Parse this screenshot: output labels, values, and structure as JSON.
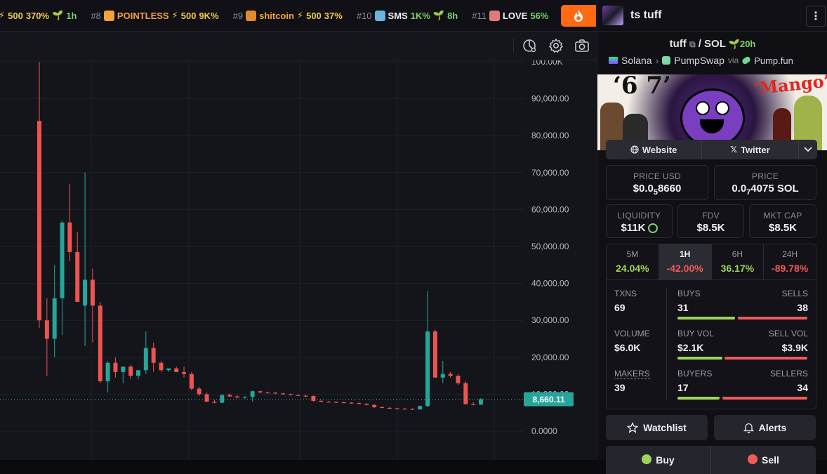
{
  "ticker": {
    "items": [
      {
        "rank": "",
        "name": "",
        "boost": "500",
        "change": "370%",
        "timeframe": "1h",
        "icon_color": ""
      },
      {
        "rank": "#8",
        "name": "POINTLESS",
        "boost": "500",
        "change": "9K%",
        "timeframe": "",
        "icon_color": "#f2a33a"
      },
      {
        "rank": "#9",
        "name": "shitcoin",
        "boost": "500",
        "change": "37%",
        "timeframe": "",
        "icon_color": "#e08a2a"
      },
      {
        "rank": "#10",
        "name": "SMS",
        "boost": "",
        "change": "1K%",
        "timeframe": "8h",
        "icon_color": "#6bb4e0"
      },
      {
        "rank": "#11",
        "name": "LOVE",
        "boost": "",
        "change": "56%",
        "timeframe": "",
        "icon_color": "#e07a7a"
      }
    ],
    "hot_icon": "fire-icon"
  },
  "toolbar": {
    "icons": [
      "indicator-icon",
      "gear-icon",
      "camera-icon"
    ]
  },
  "pair": {
    "title": "ts tuff",
    "base": "tuff",
    "separator": "/",
    "quote": "SOL",
    "age": "20h",
    "chain": "Solana",
    "dex": "PumpSwap",
    "via": "via",
    "launchpad": "Pump.fun"
  },
  "banner": {
    "text_left": "‘6 7’",
    "text_right": "‘Mango’"
  },
  "links": {
    "website": "Website",
    "twitter": "Twitter"
  },
  "prices": {
    "usd_label": "PRICE USD",
    "usd_prefix": "$0.0",
    "usd_sub": "5",
    "usd_rest": "8660",
    "native_label": "PRICE",
    "native_prefix": "0.0",
    "native_sub": "7",
    "native_rest": "4075 SOL"
  },
  "metrics": {
    "liquidity_label": "LIQUIDITY",
    "liquidity": "$11K",
    "fdv_label": "FDV",
    "fdv": "$8.5K",
    "mcap_label": "MKT CAP",
    "mcap": "$8.5K"
  },
  "timeframes": [
    {
      "label": "5M",
      "change": "24.04%",
      "dir": "pos"
    },
    {
      "label": "1H",
      "change": "-42.00%",
      "dir": "neg"
    },
    {
      "label": "6H",
      "change": "36.17%",
      "dir": "pos"
    },
    {
      "label": "24H",
      "change": "-89.78%",
      "dir": "neg"
    }
  ],
  "stats": {
    "txns_label": "TXNS",
    "txns": "69",
    "buys_label": "BUYS",
    "buys": "31",
    "sells_label": "SELLS",
    "sells": "38",
    "volume_label": "VOLUME",
    "volume": "$6.0K",
    "buyvol_label": "BUY VOL",
    "buyvol": "$2.1K",
    "sellvol_label": "SELL VOL",
    "sellvol": "$3.9K",
    "makers_label": "MAKERS",
    "makers": "39",
    "buyers_label": "BUYERS",
    "buyers": "17",
    "sellers_label": "SELLERS",
    "sellers": "34"
  },
  "actions": {
    "watchlist": "Watchlist",
    "alerts": "Alerts",
    "buy": "Buy",
    "sell": "Sell"
  },
  "colors": {
    "up": "#26a69a",
    "down": "#ef5350",
    "accent": "#ff6a13"
  },
  "chart_data": {
    "type": "candlestick",
    "y_tick_labels": [
      "100.00K",
      "90,000.00",
      "80,000.00",
      "70,000.00",
      "60,000.00",
      "50,000.00",
      "40,000.00",
      "30,000.00",
      "20,000.00",
      "10,000.00",
      "0.0000"
    ],
    "y_ticks": [
      100000,
      90000,
      80000,
      70000,
      60000,
      50000,
      40000,
      30000,
      20000,
      10000,
      0
    ],
    "ylim": [
      0,
      100000
    ],
    "current_price": 8660.11,
    "current_price_label": "8,660.11",
    "candles": [
      {
        "o": 84000,
        "h": 100000,
        "l": 28000,
        "c": 30000
      },
      {
        "o": 30000,
        "h": 36000,
        "l": 15000,
        "c": 25000
      },
      {
        "o": 25000,
        "h": 45000,
        "l": 20000,
        "c": 36000
      },
      {
        "o": 36000,
        "h": 57000,
        "l": 26000,
        "c": 56500
      },
      {
        "o": 56500,
        "h": 67000,
        "l": 46000,
        "c": 48500
      },
      {
        "o": 48500,
        "h": 54000,
        "l": 39000,
        "c": 35000
      },
      {
        "o": 34000,
        "h": 70000,
        "l": 23000,
        "c": 41000
      },
      {
        "o": 41000,
        "h": 44000,
        "l": 24000,
        "c": 34000
      },
      {
        "o": 34000,
        "h": 35000,
        "l": 13000,
        "c": 13500
      },
      {
        "o": 13500,
        "h": 19000,
        "l": 10500,
        "c": 18500
      },
      {
        "o": 18500,
        "h": 20000,
        "l": 14500,
        "c": 16000
      },
      {
        "o": 16000,
        "h": 17000,
        "l": 13000,
        "c": 17500
      },
      {
        "o": 17500,
        "h": 18000,
        "l": 14000,
        "c": 15000
      },
      {
        "o": 15000,
        "h": 16500,
        "l": 14000,
        "c": 16500
      },
      {
        "o": 16500,
        "h": 27000,
        "l": 15500,
        "c": 22500
      },
      {
        "o": 22500,
        "h": 24000,
        "l": 16000,
        "c": 18500
      },
      {
        "o": 18500,
        "h": 19000,
        "l": 16000,
        "c": 16500
      },
      {
        "o": 16500,
        "h": 17000,
        "l": 16000,
        "c": 17000
      },
      {
        "o": 17000,
        "h": 17500,
        "l": 16000,
        "c": 16000
      },
      {
        "o": 16000,
        "h": 17500,
        "l": 14500,
        "c": 15500
      },
      {
        "o": 15500,
        "h": 16000,
        "l": 11000,
        "c": 11500
      },
      {
        "o": 11500,
        "h": 12000,
        "l": 9500,
        "c": 10000
      },
      {
        "o": 10000,
        "h": 10500,
        "l": 7800,
        "c": 8000
      },
      {
        "o": 8000,
        "h": 8500,
        "l": 7500,
        "c": 7700
      },
      {
        "o": 7700,
        "h": 10000,
        "l": 7600,
        "c": 9800
      },
      {
        "o": 9800,
        "h": 10200,
        "l": 9200,
        "c": 9400
      },
      {
        "o": 9400,
        "h": 9800,
        "l": 9000,
        "c": 9100
      },
      {
        "o": 9100,
        "h": 9500,
        "l": 8800,
        "c": 9300
      },
      {
        "o": 9300,
        "h": 11000,
        "l": 8000,
        "c": 10800
      },
      {
        "o": 10800,
        "h": 11000,
        "l": 10200,
        "c": 10500
      },
      {
        "o": 10500,
        "h": 10700,
        "l": 10200,
        "c": 10400
      },
      {
        "o": 10400,
        "h": 10600,
        "l": 10000,
        "c": 10200
      },
      {
        "o": 10200,
        "h": 10400,
        "l": 9900,
        "c": 10000
      },
      {
        "o": 10000,
        "h": 10200,
        "l": 9700,
        "c": 9800
      },
      {
        "o": 9800,
        "h": 10000,
        "l": 9500,
        "c": 9600
      },
      {
        "o": 9600,
        "h": 9900,
        "l": 9300,
        "c": 9500
      },
      {
        "o": 9500,
        "h": 9700,
        "l": 8000,
        "c": 8200
      },
      {
        "o": 8200,
        "h": 8500,
        "l": 7900,
        "c": 8000
      },
      {
        "o": 8000,
        "h": 8200,
        "l": 7800,
        "c": 7900
      },
      {
        "o": 7900,
        "h": 8100,
        "l": 7700,
        "c": 7800
      },
      {
        "o": 7800,
        "h": 8000,
        "l": 7600,
        "c": 7700
      },
      {
        "o": 7700,
        "h": 7900,
        "l": 7500,
        "c": 7600
      },
      {
        "o": 7600,
        "h": 7800,
        "l": 7300,
        "c": 7400
      },
      {
        "o": 7400,
        "h": 7600,
        "l": 7000,
        "c": 7100
      },
      {
        "o": 7100,
        "h": 7300,
        "l": 6300,
        "c": 6500
      },
      {
        "o": 6500,
        "h": 6700,
        "l": 6200,
        "c": 6300
      },
      {
        "o": 6300,
        "h": 6600,
        "l": 6100,
        "c": 6200
      },
      {
        "o": 6200,
        "h": 6400,
        "l": 6000,
        "c": 6100
      },
      {
        "o": 6100,
        "h": 6300,
        "l": 5900,
        "c": 6000
      },
      {
        "o": 6000,
        "h": 6200,
        "l": 5800,
        "c": 5900
      },
      {
        "o": 5900,
        "h": 7000,
        "l": 5800,
        "c": 6800
      },
      {
        "o": 6800,
        "h": 38000,
        "l": 6500,
        "c": 27000
      },
      {
        "o": 27000,
        "h": 27500,
        "l": 14500,
        "c": 14500
      },
      {
        "o": 14500,
        "h": 19000,
        "l": 13000,
        "c": 15500
      },
      {
        "o": 15500,
        "h": 16000,
        "l": 14500,
        "c": 15000
      },
      {
        "o": 15000,
        "h": 15500,
        "l": 12500,
        "c": 13000
      },
      {
        "o": 13000,
        "h": 13500,
        "l": 7200,
        "c": 7300
      },
      {
        "o": 7300,
        "h": 7800,
        "l": 7000,
        "c": 7200
      },
      {
        "o": 7200,
        "h": 9000,
        "l": 7100,
        "c": 8660
      }
    ]
  }
}
